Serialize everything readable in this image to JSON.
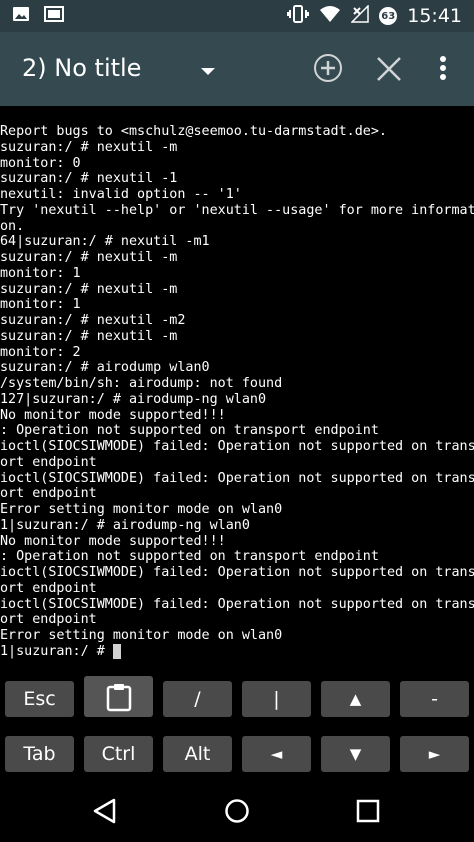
{
  "status_bar": {
    "time": "15:41",
    "battery_badge": "63",
    "icons": [
      "image-icon",
      "photo-frame-icon",
      "vibrate-icon",
      "wifi-icon",
      "no-signal-icon",
      "battery-icon"
    ]
  },
  "app_bar": {
    "session_title": "2) No title"
  },
  "terminal": {
    "lines": [
      "Report bugs to <mschulz@seemoo.tu-darmstadt.de>.",
      "suzuran:/ # nexutil -m",
      "monitor: 0",
      "suzuran:/ # nexutil -1",
      "nexutil: invalid option -- '1'",
      "Try 'nexutil --help' or 'nexutil --usage' for more informati",
      "on.",
      "64|suzuran:/ # nexutil -m1",
      "suzuran:/ # nexutil -m",
      "monitor: 1",
      "suzuran:/ # nexutil -m",
      "monitor: 1",
      "suzuran:/ # nexutil -m2",
      "suzuran:/ # nexutil -m",
      "monitor: 2",
      "suzuran:/ # airodump wlan0",
      "/system/bin/sh: airodump: not found",
      "127|suzuran:/ # airodump-ng wlan0",
      "No monitor mode supported!!!",
      ": Operation not supported on transport endpoint",
      "ioctl(SIOCSIWMODE) failed: Operation not supported on transp",
      "ort endpoint",
      "ioctl(SIOCSIWMODE) failed: Operation not supported on transp",
      "ort endpoint",
      "Error setting monitor mode on wlan0",
      "1|suzuran:/ # airodump-ng wlan0",
      "No monitor mode supported!!!",
      ": Operation not supported on transport endpoint",
      "ioctl(SIOCSIWMODE) failed: Operation not supported on transp",
      "ort endpoint",
      "ioctl(SIOCSIWMODE) failed: Operation not supported on transp",
      "ort endpoint",
      "Error setting monitor mode on wlan0"
    ],
    "prompt": "1|suzuran:/ # "
  },
  "extra_keys": {
    "esc": "Esc",
    "slash": "/",
    "pipe": "|",
    "up": "▲",
    "dash": "-",
    "tab": "Tab",
    "ctrl": "Ctrl",
    "alt": "Alt",
    "left": "◄",
    "down": "▼",
    "right": "►"
  },
  "colors": {
    "status_bar": "#2c3d44",
    "app_bar": "#344950",
    "terminal_bg": "#000000",
    "key_bg": "#4a4a4a"
  }
}
